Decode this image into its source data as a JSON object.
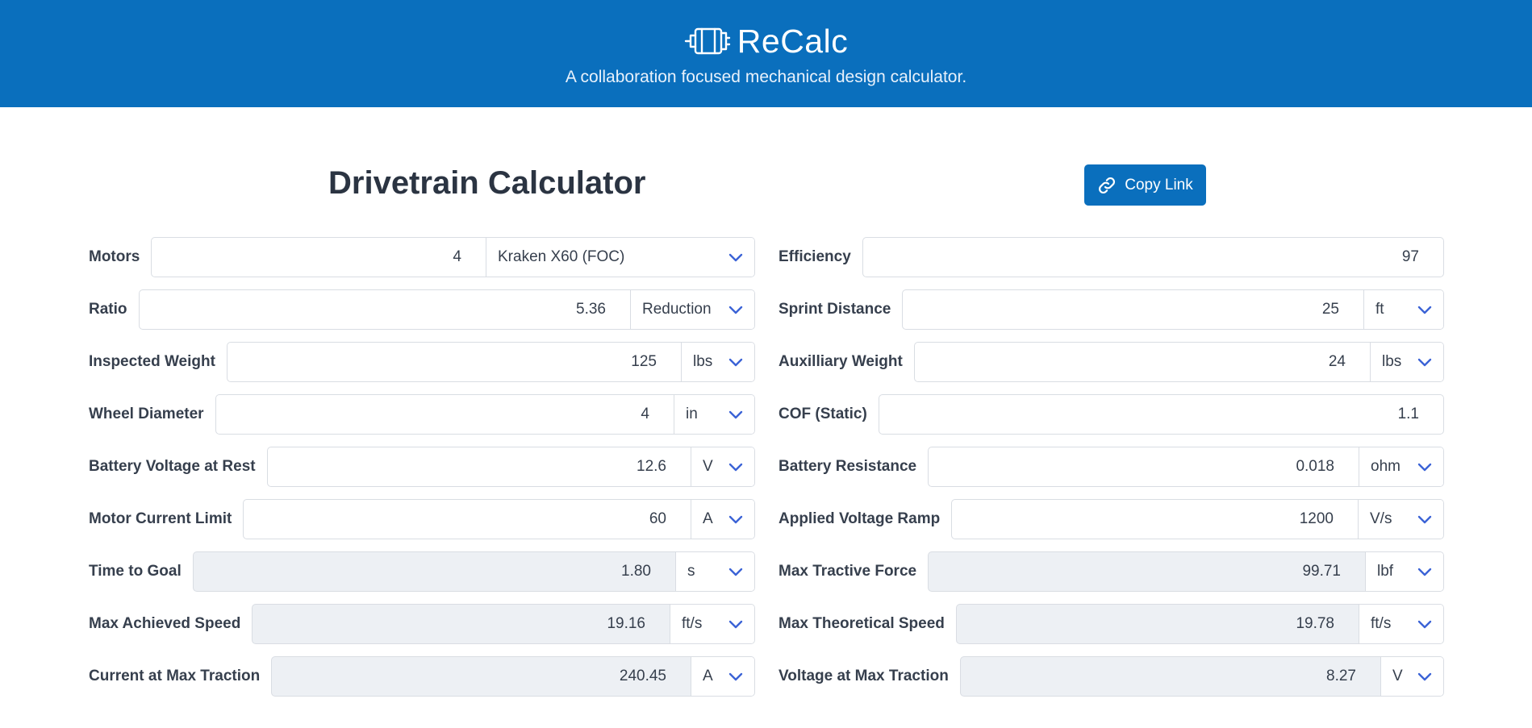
{
  "header": {
    "brand": "ReCalc",
    "tagline": "A collaboration focused mechanical design calculator."
  },
  "page_title": "Drivetrain Calculator",
  "copy_link_label": "Copy Link",
  "colors": {
    "primary": "#0a6fbd",
    "chevron": "#3b63d6",
    "output_bg": "#edf0f4"
  },
  "left": [
    {
      "label": "Motors",
      "value": "4",
      "unit": "Kraken X60 (FOC)",
      "output": false
    },
    {
      "label": "Ratio",
      "value": "5.36",
      "unit": "Reduction",
      "output": false
    },
    {
      "label": "Inspected Weight",
      "value": "125",
      "unit": "lbs",
      "output": false
    },
    {
      "label": "Wheel Diameter",
      "value": "4",
      "unit": "in",
      "output": false
    },
    {
      "label": "Battery Voltage at Rest",
      "value": "12.6",
      "unit": "V",
      "output": false
    },
    {
      "label": "Motor Current Limit",
      "value": "60",
      "unit": "A",
      "output": false
    },
    {
      "label": "Time to Goal",
      "value": "1.80",
      "unit": "s",
      "output": true
    },
    {
      "label": "Max Achieved Speed",
      "value": "19.16",
      "unit": "ft/s",
      "output": true
    },
    {
      "label": "Current at Max Traction",
      "value": "240.45",
      "unit": "A",
      "output": true
    }
  ],
  "right": [
    {
      "label": "Efficiency",
      "value": "97",
      "unit": null,
      "output": false
    },
    {
      "label": "Sprint Distance",
      "value": "25",
      "unit": "ft",
      "output": false
    },
    {
      "label": "Auxilliary Weight",
      "value": "24",
      "unit": "lbs",
      "output": false
    },
    {
      "label": "COF (Static)",
      "value": "1.1",
      "unit": null,
      "output": false
    },
    {
      "label": "Battery Resistance",
      "value": "0.018",
      "unit": "ohm",
      "output": false
    },
    {
      "label": "Applied Voltage Ramp",
      "value": "1200",
      "unit": "V/s",
      "output": false
    },
    {
      "label": "Max Tractive Force",
      "value": "99.71",
      "unit": "lbf",
      "output": true
    },
    {
      "label": "Max Theoretical Speed",
      "value": "19.78",
      "unit": "ft/s",
      "output": true
    },
    {
      "label": "Voltage at Max Traction",
      "value": "8.27",
      "unit": "V",
      "output": true
    }
  ]
}
